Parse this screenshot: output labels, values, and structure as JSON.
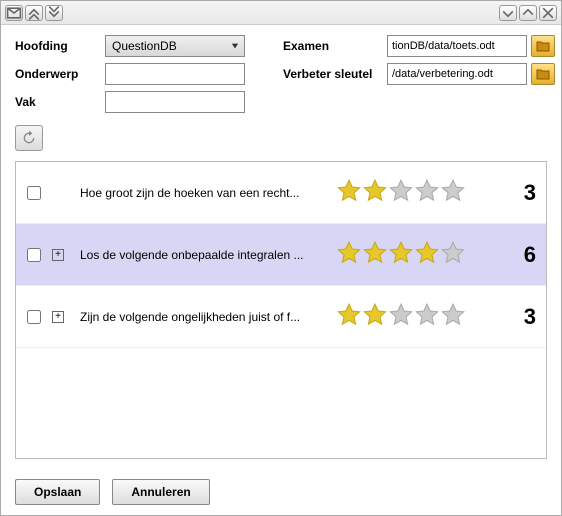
{
  "form": {
    "hoofding_label": "Hoofding",
    "hoofding_value": "QuestionDB",
    "onderwerp_label": "Onderwerp",
    "onderwerp_value": "",
    "vak_label": "Vak",
    "vak_value": "",
    "examen_label": "Examen",
    "examen_value": "tionDB/data/toets.odt",
    "verbeter_label": "Verbeter sleutel",
    "verbeter_value": "/data/verbetering.odt"
  },
  "questions": [
    {
      "text": "Hoe groot zijn de hoeken van een recht...",
      "stars": 2,
      "count": "3",
      "expandable": false,
      "selected": false
    },
    {
      "text": "Los de volgende onbepaalde integralen ...",
      "stars": 4,
      "count": "6",
      "expandable": true,
      "selected": true
    },
    {
      "text": "Zijn de volgende ongelijkheden juist of f...",
      "stars": 2,
      "count": "3",
      "expandable": true,
      "selected": false
    }
  ],
  "buttons": {
    "save": "Opslaan",
    "cancel": "Annuleren"
  }
}
